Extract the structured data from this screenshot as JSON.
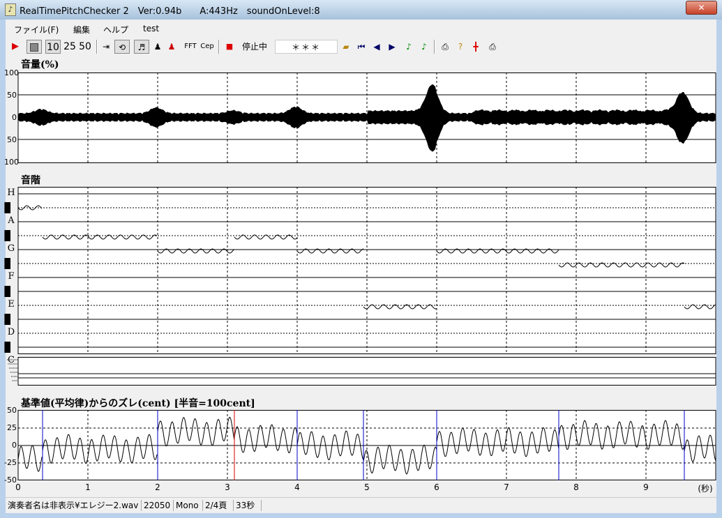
{
  "window": {
    "title": "RealTimePitchChecker 2　Ver:0.94b　　A:443Hz　soundOnLevel:8",
    "close_label": "✕"
  },
  "menu": [
    "ファイル(F)",
    "編集",
    "ヘルプ",
    "test"
  ],
  "toolbar": {
    "play_icon": "play-icon",
    "stop_icon": "stop-icon",
    "speed_10": "10",
    "speed_25": "25",
    "speed_50": "50",
    "fft_label": "FFT",
    "cep_label": "Cep",
    "status_label": "停止中",
    "note_display": "＊＊＊"
  },
  "volume_panel": {
    "title": "音量(%)",
    "ticks": [
      "100",
      "50",
      "0",
      "50",
      "100"
    ]
  },
  "scale_panel": {
    "title": "音階",
    "notes": [
      "H",
      "A",
      "G",
      "F",
      "E",
      "D",
      "C"
    ]
  },
  "cent_panel": {
    "title": "基準値(平均律)からのズレ(cent) [半音=100cent]",
    "ticks": [
      "50",
      "25",
      "0",
      "-25",
      "-50"
    ],
    "x_ticks": [
      "0",
      "1",
      "2",
      "3",
      "4",
      "5",
      "6",
      "7",
      "8",
      "9"
    ],
    "x_unit": "(秒)"
  },
  "status": {
    "file": "演奏者名は非表示¥エレジー2.wav",
    "rate": "22050",
    "channels": "Mono",
    "page": "2/4頁",
    "duration": "33秒"
  },
  "chart_data": {
    "type": "line",
    "x_unit": "seconds",
    "xlim": [
      0,
      10
    ],
    "pitch_segments": [
      {
        "start": 0.0,
        "end": 0.35,
        "note": "A#"
      },
      {
        "start": 0.35,
        "end": 2.0,
        "note": "G#"
      },
      {
        "start": 2.0,
        "end": 3.1,
        "note": "G"
      },
      {
        "start": 3.1,
        "end": 4.0,
        "note": "G#"
      },
      {
        "start": 4.0,
        "end": 4.95,
        "note": "G"
      },
      {
        "start": 4.95,
        "end": 6.0,
        "note": "D#"
      },
      {
        "start": 6.0,
        "end": 7.75,
        "note": "G"
      },
      {
        "start": 7.75,
        "end": 9.55,
        "note": "F#"
      },
      {
        "start": 9.55,
        "end": 10.0,
        "note": "D#"
      }
    ],
    "cent_ylim": [
      -50,
      50
    ],
    "volume_ylim": [
      -100,
      100
    ]
  }
}
